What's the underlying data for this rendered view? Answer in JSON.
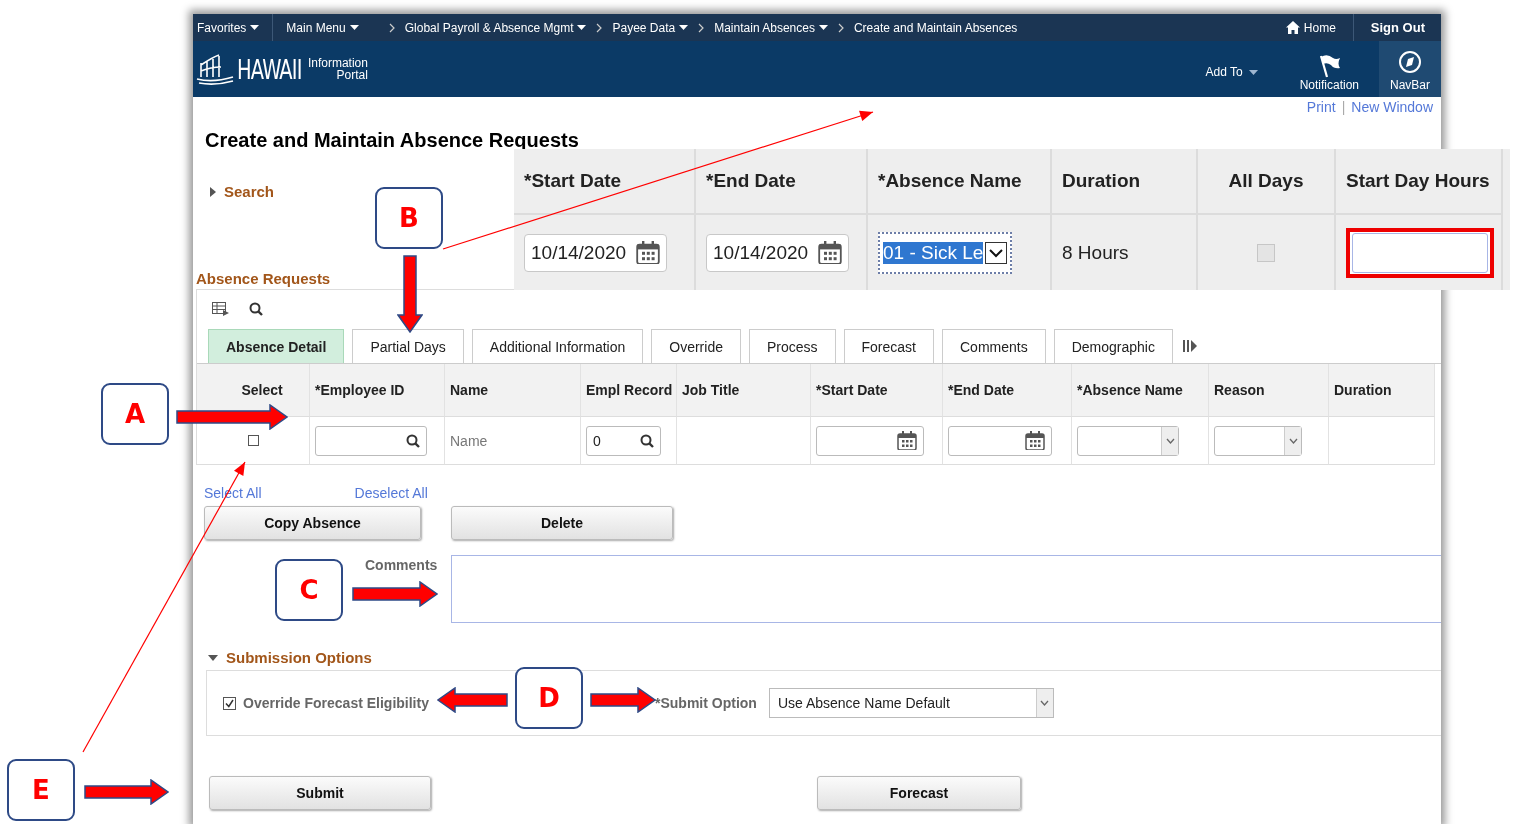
{
  "top_nav": {
    "favorites": "Favorites",
    "main_menu": "Main Menu",
    "breadcrumbs": [
      {
        "label": "Global Payroll & Absence Mgmt",
        "has_menu": true
      },
      {
        "label": "Payee Data",
        "has_menu": true
      },
      {
        "label": "Maintain Absences",
        "has_menu": true
      },
      {
        "label": "Create and Maintain Absences",
        "has_menu": false
      }
    ],
    "home": "Home",
    "sign_out": "Sign Out"
  },
  "banner": {
    "logo": "HAWAII",
    "logo_sub_1": "Information",
    "logo_sub_2": "Portal",
    "add_to": "Add To",
    "notification": "Notification",
    "navbar": "NavBar"
  },
  "page_links": [
    "Print",
    "New Window"
  ],
  "link_separator": "|",
  "title": "Create and Maintain Absence Requests",
  "search_section": {
    "label": "Search",
    "expanded": false
  },
  "grid_title": "Absence Requests",
  "tabs": [
    {
      "label": "Absence Detail",
      "selected": true
    },
    {
      "label": "Partial Days",
      "selected": false
    },
    {
      "label": "Additional Information",
      "selected": false
    },
    {
      "label": "Override",
      "selected": false
    },
    {
      "label": "Process",
      "selected": false
    },
    {
      "label": "Forecast",
      "selected": false
    },
    {
      "label": "Comments",
      "selected": false
    },
    {
      "label": "Demographic",
      "selected": false
    }
  ],
  "columns": [
    "Select",
    "*Employee ID",
    "Name",
    "Empl Record",
    "Job Title",
    "*Start Date",
    "*End Date",
    "*Absence Name",
    "Reason",
    "Duration"
  ],
  "row": {
    "selected": false,
    "name_placeholder": "Name",
    "empl_record": "0"
  },
  "select_links": [
    "Select All",
    "Deselect All"
  ],
  "row_buttons": [
    "Copy Absence",
    "Delete"
  ],
  "comments_label": "Comments",
  "submission": {
    "title": "Submission Options",
    "expanded": true,
    "override_label": "Override Forecast Eligibility",
    "override_checked": true,
    "submit_option_label": "*Submit Option",
    "submit_option_value": "Use Absence Name Default"
  },
  "footer_buttons": [
    "Submit",
    "Forecast"
  ],
  "inset": {
    "columns": [
      "*Start Date",
      "*End Date",
      "*Absence Name",
      "Duration",
      "All Days",
      "Start Day Hours"
    ],
    "start_date": "10/14/2020",
    "end_date": "10/14/2020",
    "absence_name": "01 - Sick Le",
    "duration": "8 Hours",
    "all_days_checked": false
  },
  "callouts": [
    {
      "label": "A"
    },
    {
      "label": "B"
    },
    {
      "label": "C"
    },
    {
      "label": "D"
    },
    {
      "label": "E"
    }
  ]
}
